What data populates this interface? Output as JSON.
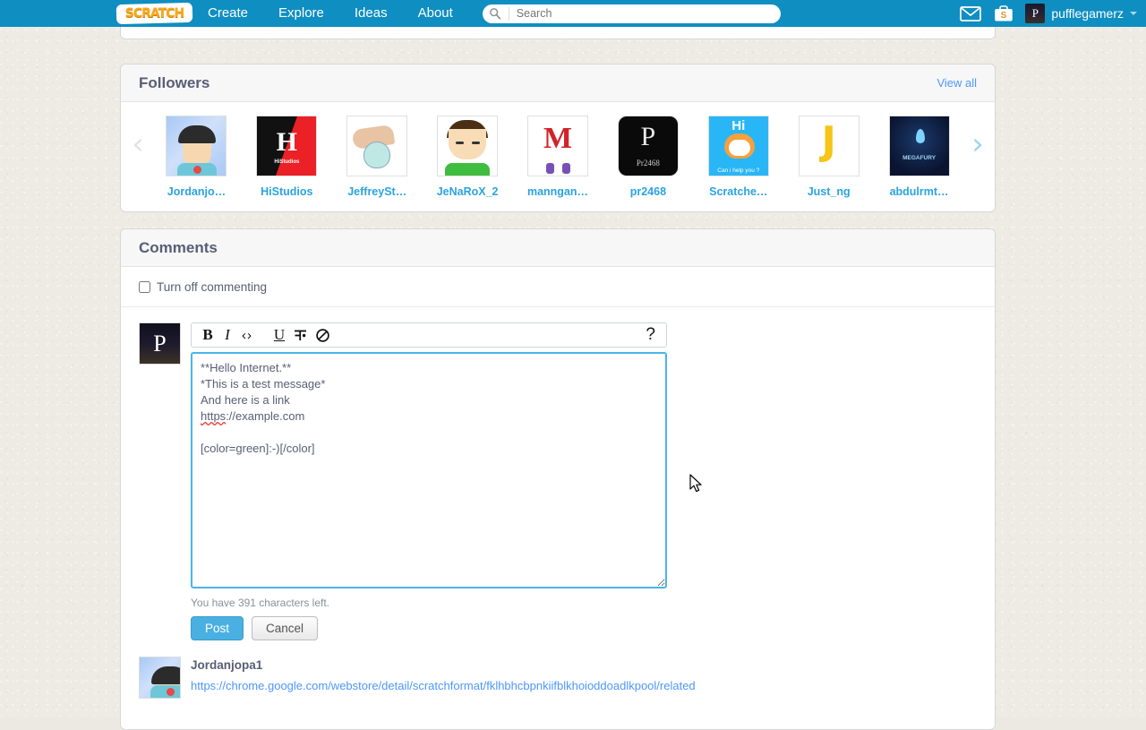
{
  "nav": {
    "logo": "SCRATCH",
    "links": [
      {
        "label": "Create"
      },
      {
        "label": "Explore"
      },
      {
        "label": "Ideas"
      },
      {
        "label": "About"
      }
    ],
    "search": {
      "value": "",
      "placeholder": "Search",
      "icon": "search-icon"
    },
    "messages_icon": "envelope-icon",
    "mystuff_icon": "briefcase-icon",
    "user": {
      "name": "pufflegamerz",
      "avatar_letter": "P",
      "caret": "▾"
    }
  },
  "followers": {
    "title": "Followers",
    "view_all": "View all",
    "prev_arrow": "‹",
    "next_arrow": "›",
    "items": [
      {
        "name": "Jordanjo…",
        "avatar": "jordanjopa1-avatar"
      },
      {
        "name": "HiStudios",
        "avatar": "histudios-avatar",
        "art_letter": "H",
        "art_caption": "HiStudios"
      },
      {
        "name": "JeffreySt…",
        "avatar": "jeffreystudios-avatar"
      },
      {
        "name": "JeNaRoX_2",
        "avatar": "jenarox2-avatar"
      },
      {
        "name": "manngan…",
        "avatar": "manngan-avatar",
        "art_letter": "M"
      },
      {
        "name": "pr2468",
        "avatar": "pr2468-avatar",
        "art_letter": "P",
        "art_caption": "Pr2468"
      },
      {
        "name": "Scratche…",
        "avatar": "scratchecat-avatar",
        "art_letter": "Hi",
        "art_caption": "Can i help you ?"
      },
      {
        "name": "Just_ng",
        "avatar": "justng-avatar",
        "art_letter": "J"
      },
      {
        "name": "abdulrmt…",
        "avatar": "abdulrmt-avatar",
        "art_caption": "MEGAFURY"
      }
    ]
  },
  "comments": {
    "title": "Comments",
    "turn_off_label": "Turn off commenting",
    "turn_off_checked": false,
    "composer": {
      "avatar_letter": "P",
      "toolbar": {
        "bold": "B",
        "italic": "I",
        "code": "‹›",
        "underline": "U",
        "strike": "╤",
        "link": "⊘",
        "help": "?"
      },
      "text": "**Hello Internet.**\n*This is a test message*\nAnd here is a link\nhttps://example.com\n\n[color=green]:-)[/color]",
      "text_lines": [
        "**Hello Internet.**",
        "*This is a test message*",
        "And here is a link",
        "https://example.com",
        "",
        "[color=green]:-)[/color]"
      ],
      "misspelled_word": "https",
      "chars_left_text": "You have 391 characters left.",
      "post_label": "Post",
      "cancel_label": "Cancel"
    },
    "list": [
      {
        "user": "Jordanjopa1",
        "avatar": "jordanjopa1-avatar",
        "link_line1": "https://chrome.google.com/webstore/detail/scratchformat/fklhbhcbpnkiifblkhoioddoa",
        "link_line2": "dlkpool/related"
      }
    ]
  },
  "colors": {
    "nav_blue": "#0f8ec1",
    "link_blue": "#4d97ff",
    "follower_name_blue": "#2aa3e0",
    "focus_border": "#4ab5e8",
    "post_button": "#4ab0e2",
    "text_gray": "#575e75",
    "page_bg": "#eeebe5"
  }
}
